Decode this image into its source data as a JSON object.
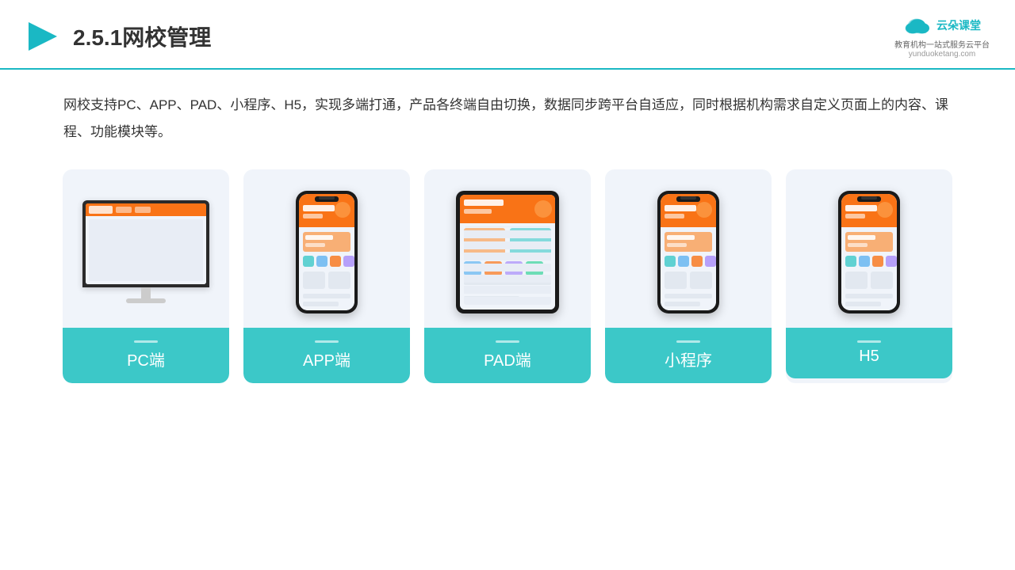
{
  "header": {
    "title": "2.5.1网校管理",
    "logo": {
      "name": "云朵课堂",
      "url": "yunduoketang.com",
      "tagline": "教育机构一站\n式服务云平台"
    }
  },
  "description": {
    "text": "网校支持PC、APP、PAD、小程序、H5，实现多端打通，产品各终端自由切换，数据同步跨平台自适应，同时根据机构需求自定义页面上的内容、课程、功能模块等。"
  },
  "cards": [
    {
      "id": "pc",
      "label": "PC端"
    },
    {
      "id": "app",
      "label": "APP端"
    },
    {
      "id": "pad",
      "label": "PAD端"
    },
    {
      "id": "miniprogram",
      "label": "小程序"
    },
    {
      "id": "h5",
      "label": "H5"
    }
  ],
  "accent_color": "#3cc8c8",
  "border_color": "#1ab8c4"
}
